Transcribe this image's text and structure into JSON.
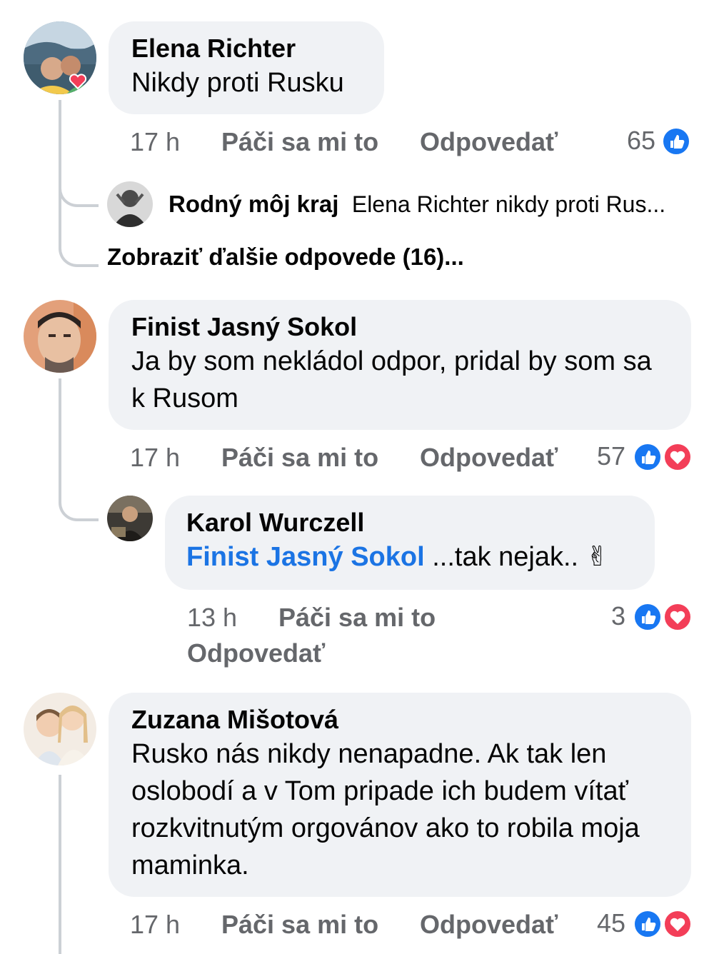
{
  "comments": [
    {
      "name": "Elena Richter",
      "text": "Nikdy proti Rusku",
      "time": "17 h",
      "like": "Páči sa mi to",
      "reply": "Odpovedať",
      "count": "65",
      "reactions": [
        "like-icon"
      ]
    },
    {
      "name": "Finist Jasný Sokol",
      "text": "Ja by som nekládol odpor, pridal by som sa k Rusom",
      "time": "17 h",
      "like": "Páči sa mi to",
      "reply": "Odpovedať",
      "count": "57",
      "reactions": [
        "like-icon",
        "love-icon"
      ]
    },
    {
      "name": "Zuzana Mišotová",
      "text": "Rusko nás nikdy nenapadne. Ak tak len oslobodí a v Tom pripade ich budem vítať rozkvitnutým orgovánov ako to robila moja maminka.",
      "time": "17 h",
      "like": "Páči sa mi to",
      "reply": "Odpovedať",
      "count": "45",
      "reactions": [
        "like-icon",
        "love-icon"
      ]
    }
  ],
  "reply_preview": {
    "name": "Rodný môj kraj",
    "text": "Elena Richter nikdy proti Rus..."
  },
  "more_replies": "Zobraziť ďalšie odpovede (16)...",
  "reply": {
    "name": "Karol Wurczell",
    "mention": "Finist Jasný Sokol",
    "text": " ...tak nejak.. ✌",
    "time": "13 h",
    "like": "Páči sa mi to",
    "reply": "Odpovedať",
    "count": "3",
    "reactions": [
      "like-icon",
      "love-icon"
    ]
  },
  "colors": {
    "bubble": "#f0f2f5",
    "meta": "#65676b",
    "like": "#1877f2",
    "love": "#f33e58",
    "mention": "#1b74e4"
  }
}
